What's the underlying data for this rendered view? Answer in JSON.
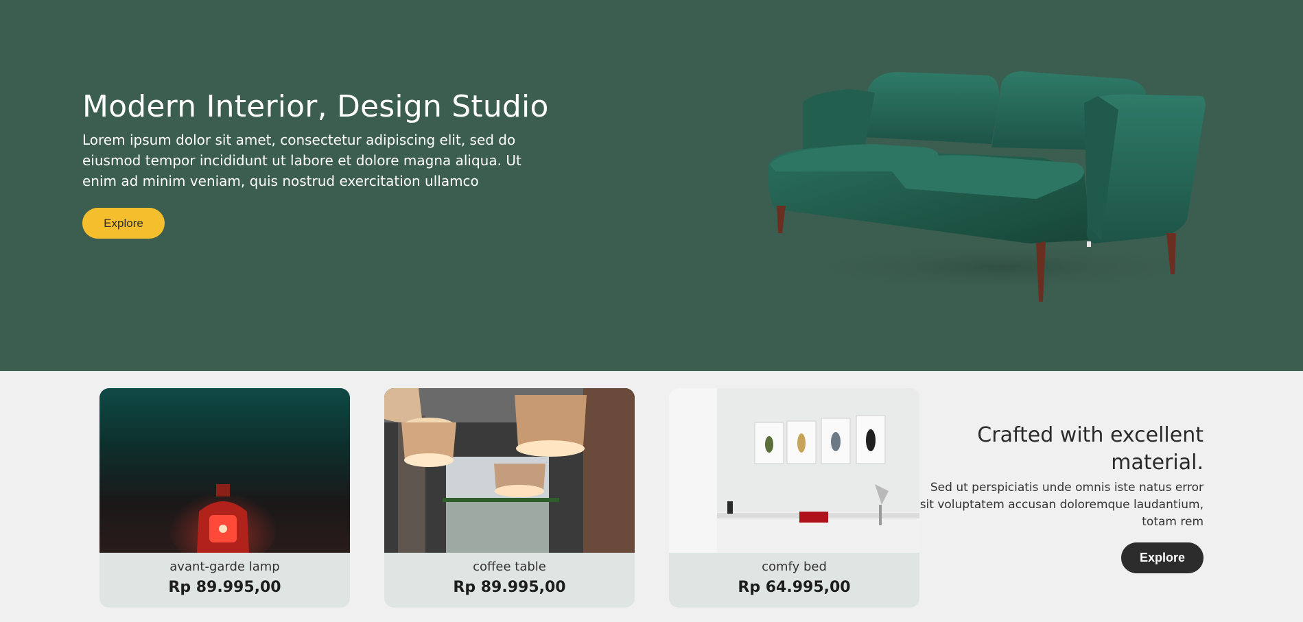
{
  "hero": {
    "title": "Modern Interior, Design Studio",
    "description": "Lorem ipsum dolor sit amet, consectetur adipiscing elit, sed do eiusmod tempor incididunt ut labore et dolore magna aliqua. Ut enim ad minim veniam, quis nostrud exercitation ullamco",
    "button_label": "Explore",
    "background": "#3c5e50",
    "button_color": "#f5be2d"
  },
  "products": [
    {
      "name": "avant-garde lamp",
      "price": "Rp 89.995,00"
    },
    {
      "name": "coffee table",
      "price": "Rp 89.995,00"
    },
    {
      "name": "comfy bed",
      "price": "Rp 64.995,00"
    }
  ],
  "crafted": {
    "title": "Crafted with excellent material.",
    "description": "Sed ut perspiciatis unde omnis iste natus error sit voluptatem accusan doloremque laudantium, totam rem",
    "button_label": "Explore"
  }
}
